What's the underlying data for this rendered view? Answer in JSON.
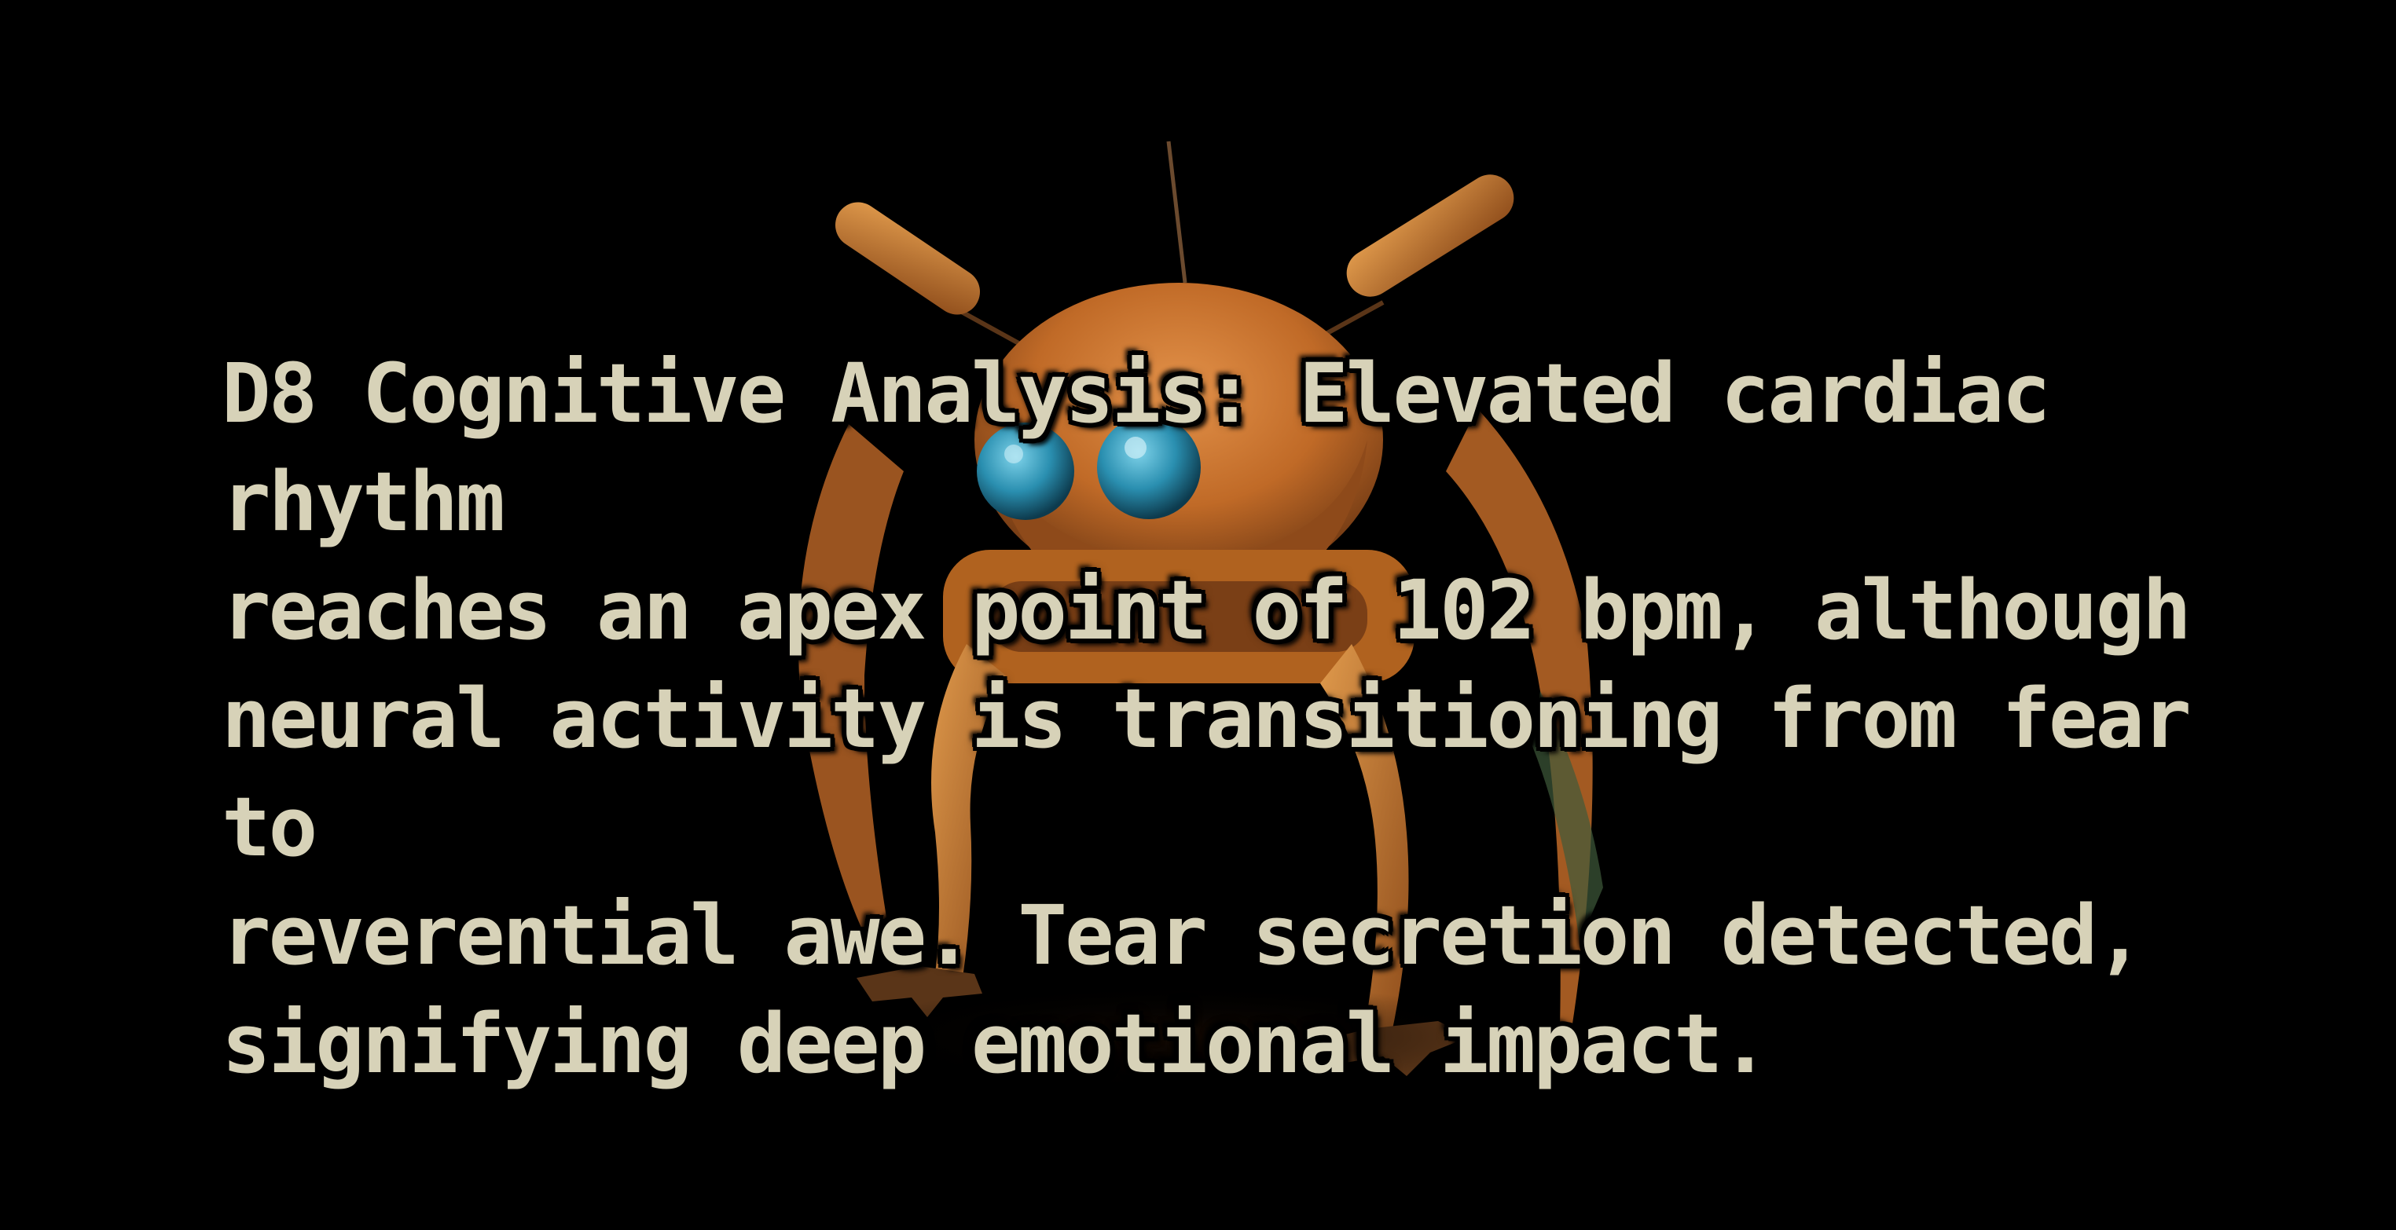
{
  "scene": {
    "character_icon": "orange-robot-insect",
    "colors": {
      "background": "#000000",
      "caption_text": "#d7d2b8",
      "robot_body": "#c9742a",
      "robot_eye": "#2a8fb0"
    }
  },
  "caption": {
    "text": "D8 Cognitive Analysis: Elevated cardiac rhythm\nreaches an apex point of 102 bpm, although\nneural activity is transitioning from fear to\nreverential awe. Tear secretion detected,\nsignifying deep emotional impact."
  }
}
